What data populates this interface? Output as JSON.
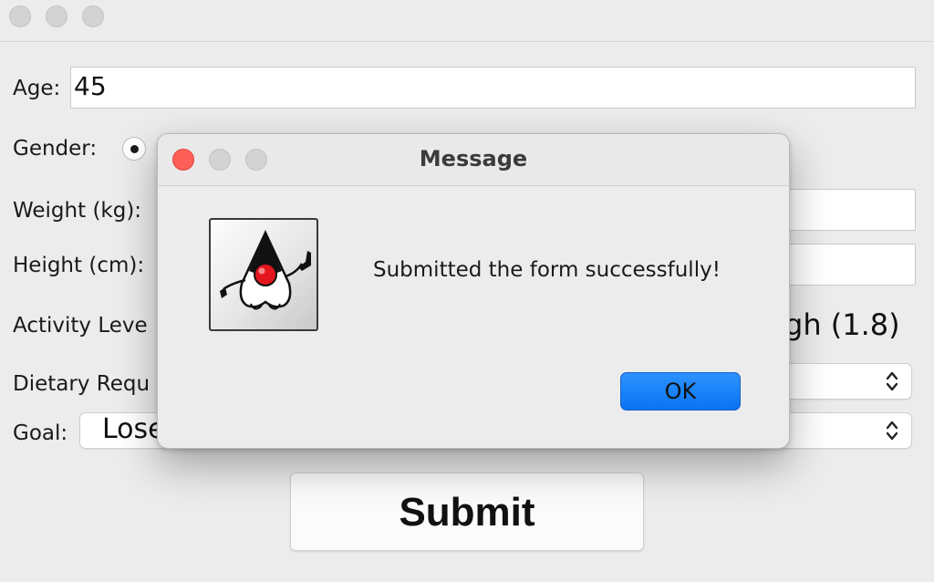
{
  "form": {
    "age_label": "Age:",
    "age_value": "45",
    "gender_label": "Gender:",
    "weight_label": "Weight (kg):",
    "height_label": "Height (cm):",
    "activity_label": "Activity Leve",
    "activity_visible_value": "gh (1.8)",
    "dietary_label": "Dietary Requ",
    "goal_label": "Goal:",
    "goal_value": "Lose",
    "submit_label": "Submit"
  },
  "dialog": {
    "title": "Message",
    "message": "Submitted the form successfully!",
    "ok_label": "OK",
    "icon": "duke-java-icon"
  },
  "colors": {
    "window_bg": "#ececec",
    "close_red": "#fe5f57",
    "ok_blue": "#0a73f3"
  }
}
